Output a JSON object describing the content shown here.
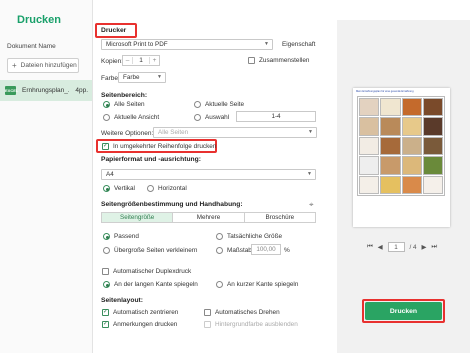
{
  "app": {
    "title": "Drucken"
  },
  "sidebar": {
    "column_title": "Dokument Name",
    "add_files": "Dateien hinzufügen",
    "file": {
      "icon": "EXCEL",
      "name": "Ernhrungsplan_...",
      "pages": "4pp."
    }
  },
  "printer": {
    "section": "Drucker",
    "selected": "Microsoft Print to PDF",
    "properties": "Eigenschaft",
    "copies_label": "Kopien:",
    "copies_value": "1",
    "collate": "Zusammenstellen",
    "color_label": "Farbe",
    "color_value": "Farbe"
  },
  "range": {
    "section": "Seitenbereich:",
    "all": "Alle Seiten",
    "current": "Aktuelle Seite",
    "current_view": "Aktuelle Ansicht",
    "selection": "Auswahl",
    "selection_value": "1-4",
    "more_label": "Weitere Optionen:",
    "more_value": "Alle Seiten",
    "reverse": "In umgekehrter Reihenfolge drucken"
  },
  "paper": {
    "section": "Papierformat und -ausrichtung:",
    "size": "A4",
    "portrait": "Vertikal",
    "landscape": "Horizontal"
  },
  "sizing": {
    "section": "Seitengrößenbestimmung und Handhabung:",
    "tabs": [
      "Seitengröße",
      "Mehrere",
      "Broschüre"
    ],
    "fit": "Passend",
    "actual": "Tatsächliche Größe",
    "shrink": "Übergroße Seiten verkleinern",
    "scale": "Maßstab",
    "scale_value": "100,00",
    "percent": "%",
    "duplex": "Automatischer Duplexdruck",
    "long_edge": "An der langen Kante spiegeln",
    "short_edge": "An kurzer Kante spiegeln"
  },
  "layout": {
    "section": "Seitenlayout:",
    "center": "Automatisch zentrieren",
    "rotate": "Automatisches Drehen",
    "annotations": "Anmerkungen drucken",
    "hide_bg": "Hintergrundfarbe ausblenden"
  },
  "preview": {
    "page": "1",
    "total": "/ 4",
    "doc_title": "Mein Ernährungsplan für eine gesunde Ernährung"
  },
  "actions": {
    "print": "Drucken"
  },
  "colors": {
    "accent": "#2aa463",
    "highlight": "#e8312f"
  }
}
